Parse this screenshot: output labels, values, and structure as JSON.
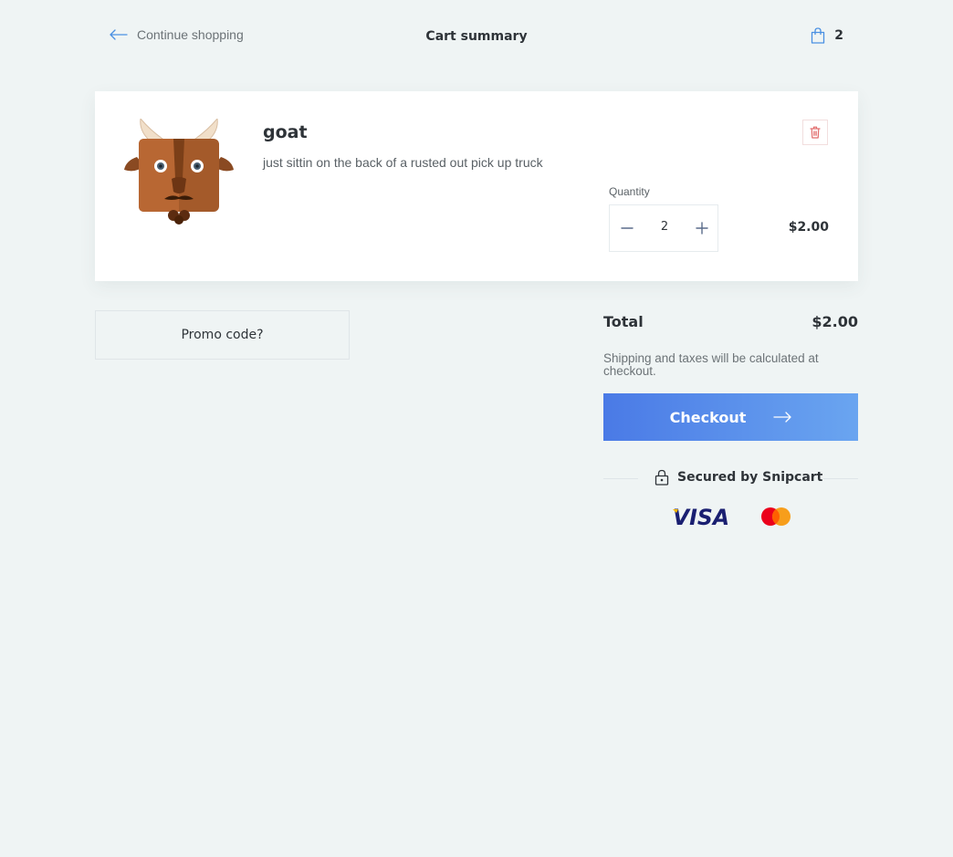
{
  "header": {
    "continue_label": "Continue shopping",
    "title": "Cart summary",
    "cart_count": "2",
    "continue_icon": "arrow-left-icon",
    "cart_icon": "shopping-bag-icon"
  },
  "item": {
    "name": "goat",
    "description": "just sittin on the back of a rusted out pick up truck",
    "image_icon": "goat-avatar",
    "quantity_label": "Quantity",
    "quantity": "2",
    "price": "$2.00",
    "remove_icon": "trash-icon",
    "minus_icon": "minus-icon",
    "plus_icon": "plus-icon"
  },
  "promo": {
    "label": "Promo code?"
  },
  "summary": {
    "total_label": "Total",
    "total_value": "$2.00",
    "shipping_note": "Shipping and taxes will be calculated at checkout.",
    "checkout_label": "Checkout",
    "checkout_icon": "arrow-right-icon",
    "secured_label": "Secured by Snipcart",
    "secured_icon": "lock-icon",
    "payment_methods": [
      "VISA",
      "Mastercard"
    ]
  },
  "colors": {
    "background": "#eff4f4",
    "accent": "#4a7ae6",
    "danger": "#e26d6d",
    "text": "#2e3338",
    "visa": "#1a1f71",
    "mastercard_red": "#eb001b",
    "mastercard_orange": "#f79e1b"
  }
}
